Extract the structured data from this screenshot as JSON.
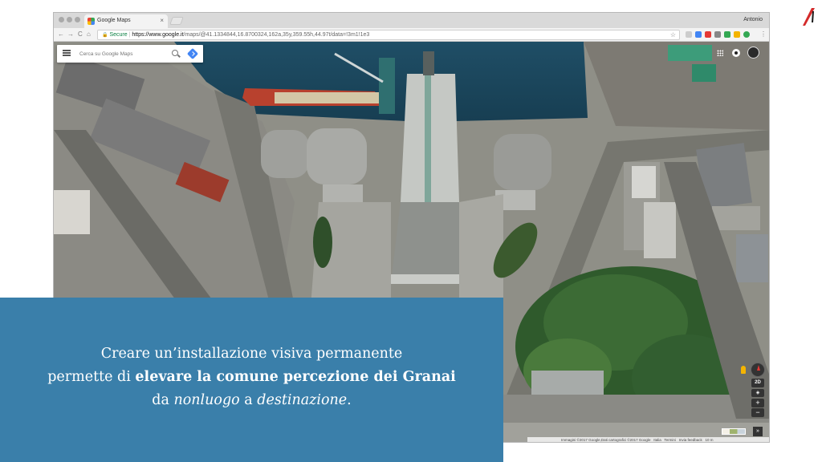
{
  "colors": {
    "caption_background": "#3a7faa",
    "caption_text": "#ffffff",
    "logo_red": "#d42a2a",
    "secure_green": "#0b8043",
    "google_blue": "#4285f4"
  },
  "slide": {
    "logo_icon": "red-slash-logo-icon"
  },
  "browser": {
    "tab_title": "Google Maps",
    "tab_close": "×",
    "profile_name": "Antonio",
    "nav": {
      "back": "←",
      "forward": "→",
      "reload": "C",
      "home": "⌂"
    },
    "address": {
      "lock": "🔒",
      "secure_label": "Secure",
      "separator": " | ",
      "url_host": "https://www.google.it",
      "url_rest": "/maps/@41.1334844,16.8700324,162a,35y,359.55h,44.97t/data=!3m1!1e3",
      "bookmark": "☆"
    },
    "extensions": [
      "extension-icon",
      "extension-icon",
      "extension-icon",
      "extension-icon",
      "extension-icon",
      "extension-icon",
      "extension-icon",
      "extension-icon"
    ]
  },
  "maps": {
    "search_placeholder": "Cerca su Google Maps",
    "icons": [
      "menu-icon",
      "search-icon",
      "directions-icon",
      "apps-grid-icon",
      "notifications-icon",
      "account-avatar"
    ],
    "controls": {
      "toggle_2d": "2D",
      "tilt": "◈",
      "zoom_in": "+",
      "zoom_out": "−",
      "expand": "»"
    },
    "attribution": {
      "imagery": "Immagini ©2017 Google,Dati cartografici ©2017 Google",
      "country": "Italia",
      "terms": "Termini",
      "feedback": "Invia feedback",
      "scale": "10 m"
    }
  },
  "caption": {
    "line1": "Creare un’installazione visiva permanente",
    "line2_prefix": "permette di ",
    "line2_bold": "elevare la comune percezione dei Granai",
    "line3_prefix": "da ",
    "line3_italic_1": "nonluogo",
    "line3_middle": " a ",
    "line3_italic_2": "destinazione",
    "line3_suffix": "."
  }
}
